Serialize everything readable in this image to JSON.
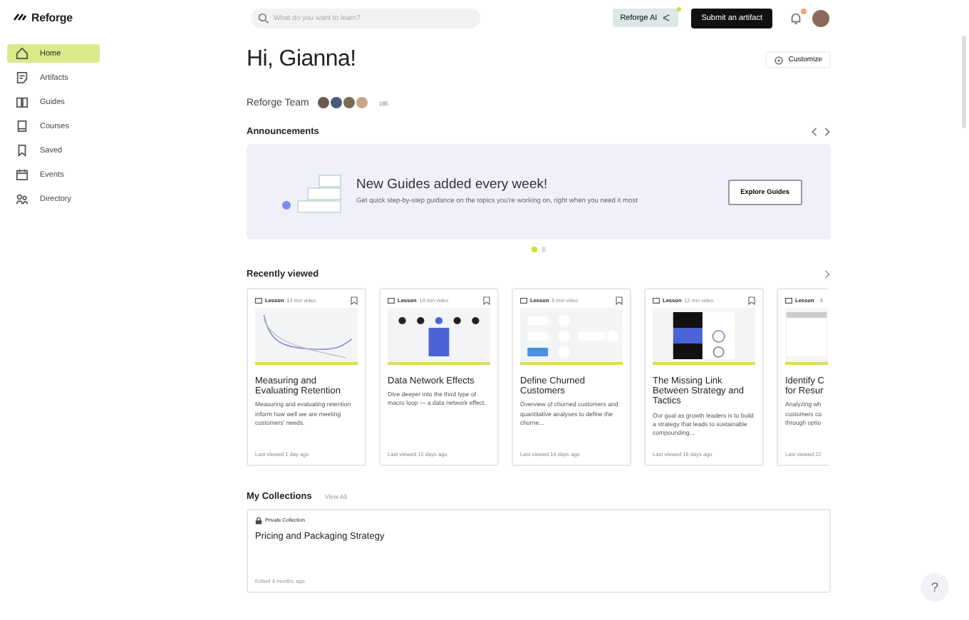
{
  "logo": {
    "text": "Reforge"
  },
  "sidebar": {
    "items": [
      {
        "label": "Home",
        "selected": true
      },
      {
        "label": "Artifacts",
        "selected": false
      },
      {
        "label": "Guides",
        "selected": false
      },
      {
        "label": "Courses",
        "selected": false
      },
      {
        "label": "Saved",
        "selected": false
      },
      {
        "label": "Events",
        "selected": false
      },
      {
        "label": "Directory",
        "selected": false
      }
    ]
  },
  "search": {
    "placeholder": "What do you want to learn?"
  },
  "top_bar": {
    "ai_button": "Reforge AI",
    "ai_new": true,
    "submit_button": "Submit an artifact",
    "notifications_unread": true
  },
  "greeting": "Hi, Gianna!",
  "customize_button": "Customize",
  "team": {
    "name": "Reforge Team",
    "count": "185"
  },
  "announcements": {
    "title": "Announcements",
    "banner_title": "New Guides added every week!",
    "banner_text": "Get quick step-by-step guidance on the topics you're working on, right when you need it most",
    "button": "Explore Guides",
    "pages": [
      {
        "selected": true
      },
      {
        "selected": false
      }
    ]
  },
  "recently_viewed": {
    "title": "Recently viewed",
    "cards": [
      {
        "type": "Lesson",
        "duration": "13 min video",
        "title": "Measuring and Evaluating Retention",
        "text": "Measuring and evaluating retention inform how well we are meeting customers' needs.",
        "viewed": "Last viewed 1 day ago"
      },
      {
        "type": "Lesson",
        "duration": "14 min video",
        "title": "Data Network Effects",
        "text": "Dive deeper into the third type of macro loop — a data network effect.",
        "viewed": "Last viewed 15 days ago"
      },
      {
        "type": "Lesson",
        "duration": "5 min video",
        "title": "Define Churned Customers",
        "text": "Overview of churned customers and quantitative analyses to define the churne...",
        "viewed": "Last viewed 16 days ago"
      },
      {
        "type": "Lesson",
        "duration": "12 min video",
        "title": "The Missing Link Between Strategy and Tactics",
        "text": "Our goal as growth leaders is to build a strategy that leads to sustainable compounding...",
        "viewed": "Last viewed 16 days ago"
      },
      {
        "type": "Lesson",
        "duration": "· 8",
        "title": "Identify C for Resur",
        "text": "Analyzing wh customers co through optio",
        "viewed": "Last viewed 22"
      }
    ]
  },
  "collections": {
    "title": "My Collections",
    "view_all": "View All",
    "items": [
      {
        "label": "Private Collection",
        "title": "Pricing and Packaging Strategy",
        "edited": "Edited 4 months ago"
      }
    ]
  },
  "help_button": "?"
}
